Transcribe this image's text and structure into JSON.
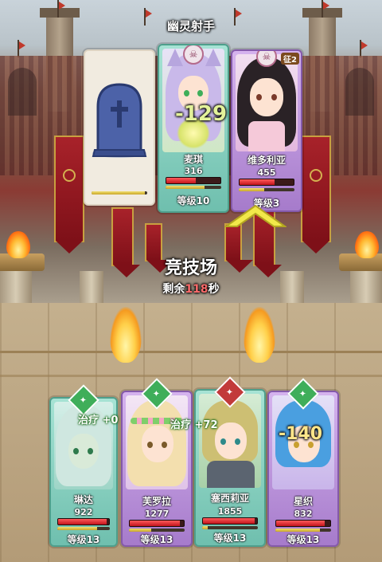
{
  "enemy_team_label": "幽灵射手",
  "arena": {
    "title": "竞技场",
    "timer_prefix": "剩余",
    "timer_value": "118",
    "timer_suffix": "秒"
  },
  "enemies": [
    {
      "slot": "dead",
      "icon": "tombstone",
      "hp_fraction": 0,
      "energy_fraction": 0.95
    },
    {
      "name": "麦琪",
      "hp": "316",
      "level": "等级10",
      "hp_fraction": 0.55,
      "energy_fraction": 0.7,
      "damage_popup": "-129",
      "hair_color": "#c9b9ea"
    },
    {
      "name": "维多利亚",
      "hp": "455",
      "level": "等级3",
      "hp_fraction": 0.65,
      "energy_fraction": 0.45,
      "tag": "征2",
      "hair_color": "#2a2226"
    }
  ],
  "allies": [
    {
      "name": "琳达",
      "hp": "922",
      "level": "等级13",
      "hp_fraction": 0.95,
      "energy_fraction": 0.75,
      "heal_popup": "治疗 +0",
      "hair_color": "#cfe7e0",
      "element": "#3fae5a"
    },
    {
      "name": "芙罗拉",
      "hp": "1277",
      "level": "等级13",
      "hp_fraction": 0.92,
      "energy_fraction": 0.4,
      "hair_color": "#f3dfae",
      "element": "#3fae5a"
    },
    {
      "name": "塞西莉亚",
      "hp": "1855",
      "level": "等级13",
      "hp_fraction": 0.95,
      "energy_fraction": 0.1,
      "heal_popup": "治疗 +72",
      "hair_color": "#cdbf73",
      "element": "#c23a3a"
    },
    {
      "name": "星织",
      "hp": "832",
      "level": "等级13",
      "hp_fraction": 0.9,
      "energy_fraction": 0.8,
      "damage_popup": "-140",
      "hair_color": "#4a9fe0",
      "element": "#3fae5a"
    }
  ],
  "colors": {
    "hp": "#d81e26",
    "energy": "#e3c94a",
    "heal": "#e8ff50",
    "damage": "#ffe68a"
  }
}
